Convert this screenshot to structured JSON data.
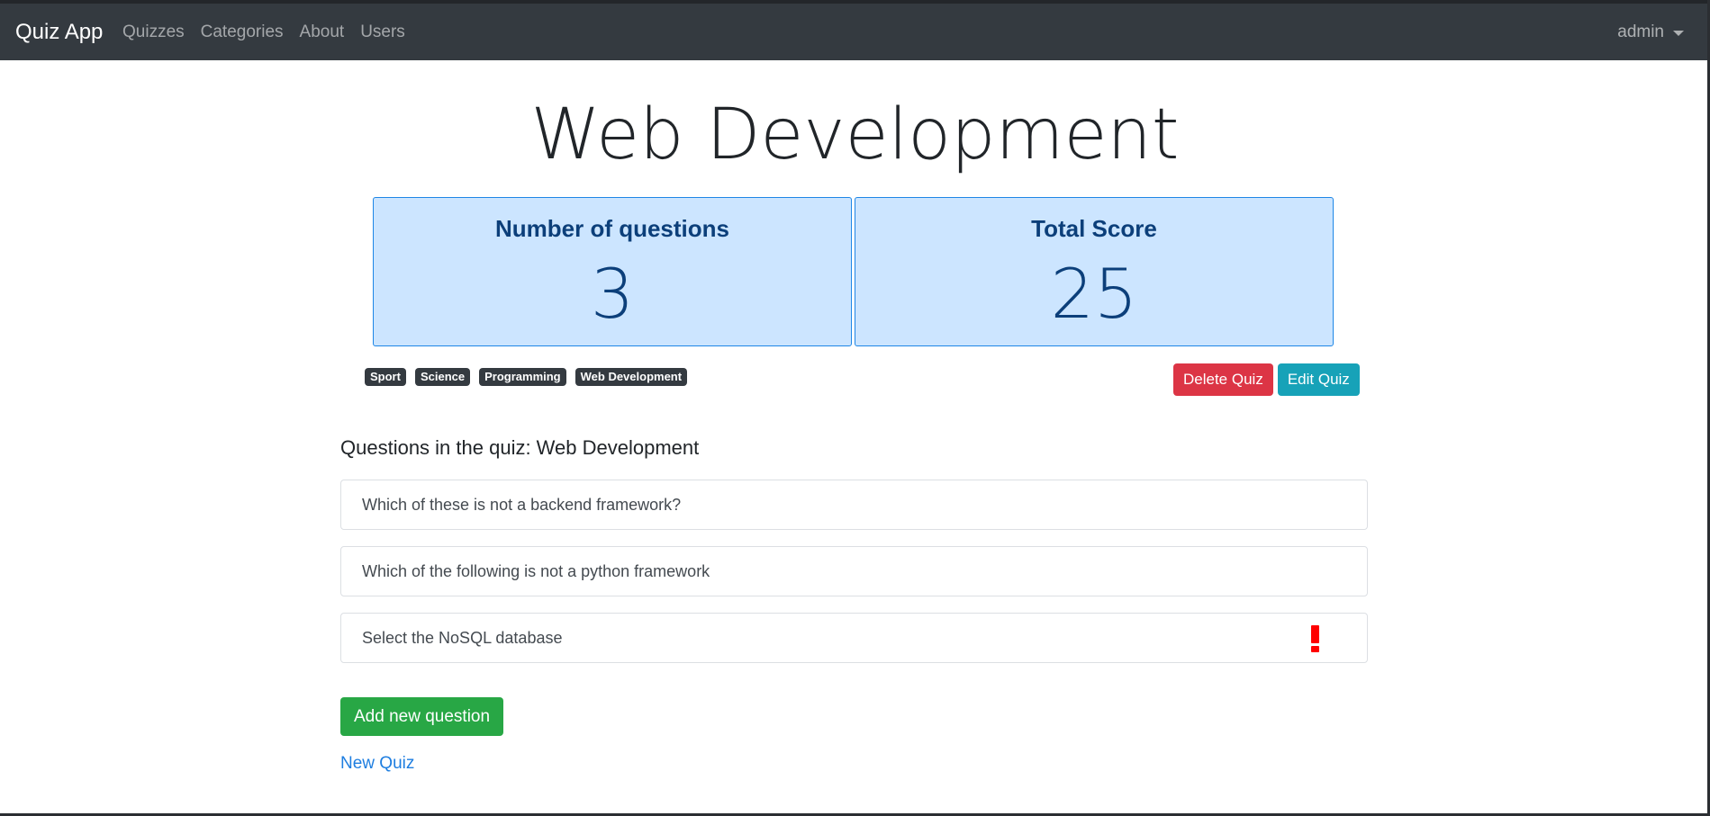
{
  "navbar": {
    "brand": "Quiz App",
    "links": [
      "Quizzes",
      "Categories",
      "About",
      "Users"
    ],
    "user": "admin"
  },
  "quiz": {
    "title": "Web Development",
    "stats": {
      "questions_label": "Number of questions",
      "questions_value": "3",
      "score_label": "Total Score",
      "score_value": "25"
    },
    "tags": [
      "Sport",
      "Science",
      "Programming",
      "Web Development"
    ],
    "buttons": {
      "delete": "Delete Quiz",
      "edit": "Edit Quiz"
    }
  },
  "questions": {
    "heading": "Questions in the quiz: Web Development",
    "items": [
      {
        "text": "Which of these is not a backend framework?",
        "warning": false
      },
      {
        "text": "Which of the following is not a python framework",
        "warning": false
      },
      {
        "text": "Select the NoSQL database",
        "warning": true
      }
    ]
  },
  "actions": {
    "add_question": "Add new question",
    "new_quiz": "New Quiz"
  },
  "colors": {
    "navbar": "#343a40",
    "stat_background": "#cce5ff",
    "stat_border": "#1e86e6",
    "stat_text": "#0c3f7a",
    "danger": "#dc3545",
    "info": "#17a2b8",
    "success": "#28a745",
    "link": "#1e7ee0",
    "warning_icon": "#ff0000"
  }
}
